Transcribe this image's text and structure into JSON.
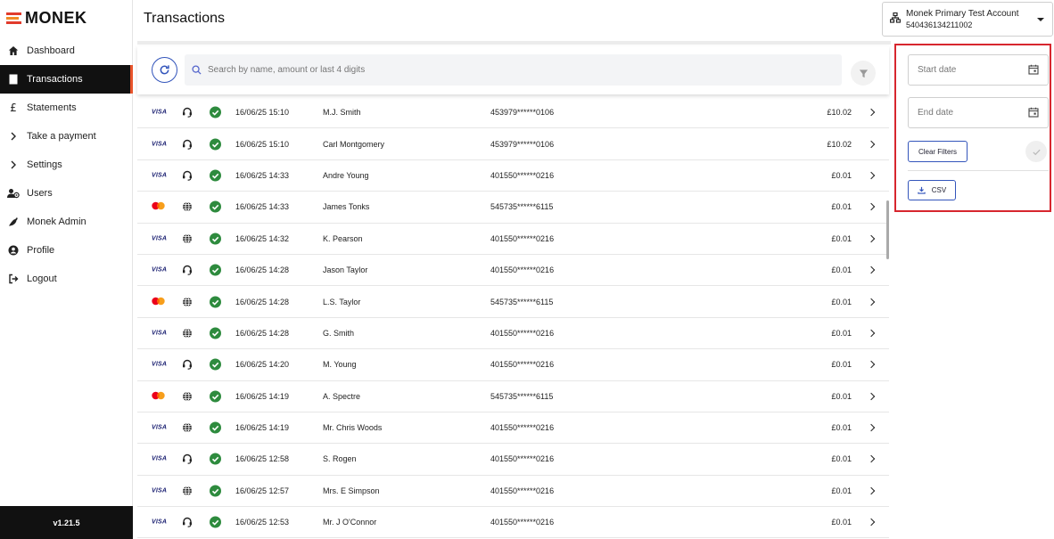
{
  "brand": {
    "name": "MONEK"
  },
  "sidebar": {
    "items": [
      {
        "label": "Dashboard",
        "icon": "home-icon"
      },
      {
        "label": "Transactions",
        "icon": "document-icon",
        "active": true
      },
      {
        "label": "Statements",
        "icon": "pound-icon"
      },
      {
        "label": "Take a payment",
        "icon": "chevron-right-icon"
      },
      {
        "label": "Settings",
        "icon": "chevron-right-icon"
      },
      {
        "label": "Users",
        "icon": "users-icon"
      },
      {
        "label": "Monek Admin",
        "icon": "pepper-icon"
      },
      {
        "label": "Profile",
        "icon": "user-circle-icon"
      },
      {
        "label": "Logout",
        "icon": "logout-icon"
      }
    ],
    "version": "v1.21.5"
  },
  "header": {
    "title": "Transactions",
    "account_name": "Monek Primary Test Account",
    "account_number": "540436134211002"
  },
  "search": {
    "placeholder": "Search by name, amount or last 4 digits"
  },
  "transactions": [
    {
      "brand": "visa",
      "channel": "phone",
      "date": "16/06/25 15:10",
      "name": "M.J. Smith",
      "card": "453979******0106",
      "amount": "£10.02"
    },
    {
      "brand": "visa",
      "channel": "phone",
      "date": "16/06/25 15:10",
      "name": "Carl Montgomery",
      "card": "453979******0106",
      "amount": "£10.02"
    },
    {
      "brand": "visa",
      "channel": "phone",
      "date": "16/06/25 14:33",
      "name": "Andre Young",
      "card": "401550******0216",
      "amount": "£0.01"
    },
    {
      "brand": "mastercard",
      "channel": "web",
      "date": "16/06/25 14:33",
      "name": "James Tonks",
      "card": "545735******6115",
      "amount": "£0.01"
    },
    {
      "brand": "visa",
      "channel": "web",
      "date": "16/06/25 14:32",
      "name": "K. Pearson",
      "card": "401550******0216",
      "amount": "£0.01"
    },
    {
      "brand": "visa",
      "channel": "phone",
      "date": "16/06/25 14:28",
      "name": "Jason Taylor",
      "card": "401550******0216",
      "amount": "£0.01"
    },
    {
      "brand": "mastercard",
      "channel": "web",
      "date": "16/06/25 14:28",
      "name": "L.S. Taylor",
      "card": "545735******6115",
      "amount": "£0.01"
    },
    {
      "brand": "visa",
      "channel": "web",
      "date": "16/06/25 14:28",
      "name": "G. Smith",
      "card": "401550******0216",
      "amount": "£0.01"
    },
    {
      "brand": "visa",
      "channel": "phone",
      "date": "16/06/25 14:20",
      "name": "M. Young",
      "card": "401550******0216",
      "amount": "£0.01"
    },
    {
      "brand": "mastercard",
      "channel": "web",
      "date": "16/06/25 14:19",
      "name": "A. Spectre",
      "card": "545735******6115",
      "amount": "£0.01"
    },
    {
      "brand": "visa",
      "channel": "web",
      "date": "16/06/25 14:19",
      "name": "Mr. Chris Woods",
      "card": "401550******0216",
      "amount": "£0.01"
    },
    {
      "brand": "visa",
      "channel": "phone",
      "date": "16/06/25 12:58",
      "name": "S. Rogen",
      "card": "401550******0216",
      "amount": "£0.01"
    },
    {
      "brand": "visa",
      "channel": "web",
      "date": "16/06/25 12:57",
      "name": "Mrs. E Simpson",
      "card": "401550******0216",
      "amount": "£0.01"
    },
    {
      "brand": "visa",
      "channel": "phone",
      "date": "16/06/25 12:53",
      "name": "Mr. J O'Connor",
      "card": "401550******0216",
      "amount": "£0.01"
    }
  ],
  "filters": {
    "start_date_placeholder": "Start date",
    "end_date_placeholder": "End date",
    "clear_label": "Clear Filters",
    "csv_label": "CSV"
  },
  "colors": {
    "accent_blue": "#3355bb",
    "active_nav_bg": "#111111",
    "active_nav_indicator": "#e8542b",
    "status_success": "#2e8b3e",
    "highlight_border": "#d7262e"
  }
}
